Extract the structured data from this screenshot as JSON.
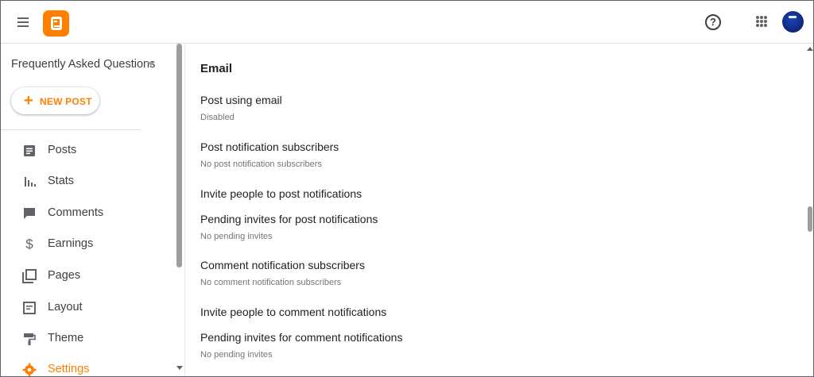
{
  "header": {
    "menu_icon": "hamburger-menu-icon",
    "logo_icon": "blogger-logo-icon",
    "help_icon": "help-circle-icon",
    "apps_icon": "apps-grid-icon",
    "avatar_icon": "account-avatar",
    "help_glyph": "?"
  },
  "sidebar": {
    "blog_name": "Frequently Asked Questions",
    "new_post_plus": "+",
    "new_post_label": "NEW POST",
    "items": [
      {
        "label": "Posts",
        "icon": "posts-icon"
      },
      {
        "label": "Stats",
        "icon": "stats-icon"
      },
      {
        "label": "Comments",
        "icon": "comments-icon"
      },
      {
        "label": "Earnings",
        "icon": "dollar-icon"
      },
      {
        "label": "Pages",
        "icon": "pages-icon"
      },
      {
        "label": "Layout",
        "icon": "layout-icon"
      },
      {
        "label": "Theme",
        "icon": "paint-roller-icon"
      },
      {
        "label": "Settings",
        "icon": "gear-icon",
        "active": true
      }
    ]
  },
  "main": {
    "section_title": "Email",
    "rows": [
      {
        "title": "Post using email",
        "subtitle": "Disabled"
      },
      {
        "title": "Post notification subscribers",
        "subtitle": "No post notification subscribers"
      },
      {
        "title": "Invite people to post notifications",
        "subtitle": ""
      },
      {
        "title": "Pending invites for post notifications",
        "subtitle": "No pending invites"
      },
      {
        "title": "Comment notification subscribers",
        "subtitle": "No comment notification subscribers"
      },
      {
        "title": "Invite people to comment notifications",
        "subtitle": ""
      },
      {
        "title": "Pending invites for comment notifications",
        "subtitle": "No pending invites"
      }
    ]
  },
  "colors": {
    "accent": "#ff8000",
    "text": "#212121",
    "secondary_text": "#757575",
    "icon": "#5f6368"
  }
}
